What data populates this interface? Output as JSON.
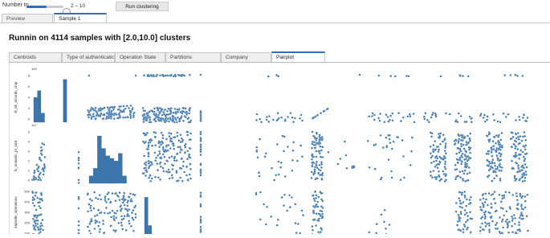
{
  "slider": {
    "label": "Number to ...",
    "range_text": "2 – 10",
    "level_fraction": 0.55
  },
  "run_button": {
    "label": "Run clustering"
  },
  "outer_tabs": [
    {
      "label": "Preview",
      "active": false
    },
    {
      "label": "Sample 1",
      "active": true
    }
  ],
  "heading": "Runnin on 4114 samples with [2.0,10.0] clusters",
  "inner_tabs": [
    {
      "label": "Centroids",
      "active": false
    },
    {
      "label": "Type of authentication",
      "active": false
    },
    {
      "label": "Operation State",
      "active": false
    },
    {
      "label": "Partitions",
      "active": false
    },
    {
      "label": "Company",
      "active": false
    },
    {
      "label": "Pairplot",
      "active": true
    }
  ],
  "pairplot": {
    "point_color": "#3b75af",
    "rows": [
      {
        "ylabel": "ill_nb_records_crsp",
        "scale": "1e9",
        "ticks": [
          "0",
          "2",
          "4",
          "6",
          "8"
        ]
      },
      {
        "ylabel": "fs_numeric_pt_size",
        "scale": "1e7",
        "ticks": [
          "0",
          "1",
          "2",
          "3",
          "4",
          "5"
        ]
      },
      {
        "ylabel": "impedie_operations",
        "scale": "",
        "ticks": [
          "100",
          "200",
          "300",
          "400",
          "500"
        ]
      }
    ]
  }
}
